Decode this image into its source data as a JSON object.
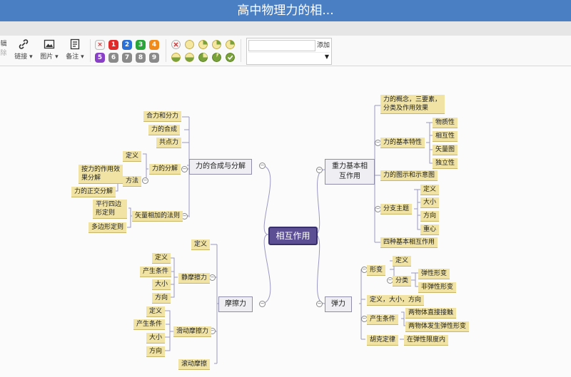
{
  "window": {
    "title": "高中物理力的相..."
  },
  "toolbar": {
    "partial_top": "辑",
    "partial_bottom": "除",
    "link": "链接",
    "image": "图片",
    "note": "备注",
    "priority_icons": [
      "×",
      "1",
      "2",
      "3",
      "4",
      "5",
      "6",
      "7",
      "8",
      "9"
    ],
    "priority_colors": [
      "#f5f5f5",
      "#e02a2a",
      "#2a6fd6",
      "#2aa53a",
      "#f08a1a",
      "#8a3fc9",
      "#8a8a8a",
      "#8a8a8a",
      "#8a8a8a",
      "#8a8a8a"
    ],
    "add_label": "添加"
  },
  "map": {
    "center": "相互作用",
    "b1": {
      "label": "力的合成与分解",
      "n1": "合力和分力",
      "n2": "力的合成",
      "n3": "共点力",
      "n4": "力的分解",
      "n4a": "定义",
      "n4b": "方法",
      "n4b1": "按力的作用效果分解",
      "n4b2": "力的正交分解",
      "n5": "矢量相加的法则",
      "n5a": "平行四边形定则",
      "n5b": "多边形定则"
    },
    "b2": {
      "label": "重力基本相互作用",
      "n1": "力的概念，三要素，分类及作用效果",
      "n2": "力的基本特性",
      "n2a": "物质性",
      "n2b": "相互性",
      "n2c": "矢量图",
      "n2d": "独立性",
      "n3": "力的图示和示意图",
      "n4": "分支主题",
      "n4a": "定义",
      "n4b": "大小",
      "n4c": "方向",
      "n4d": "重心",
      "n5": "四种基本相互作用"
    },
    "b3": {
      "label": "摩擦力",
      "n1": "定义",
      "n2": "静摩擦力",
      "n2a": "定义",
      "n2b": "产生条件",
      "n2c": "大小",
      "n2d": "方向",
      "n3": "滑动摩擦力",
      "n3a": "定义",
      "n3b": "产生条件",
      "n3c": "大小",
      "n3d": "方向",
      "n4": "滚动摩擦"
    },
    "b4": {
      "label": "弹力",
      "n1": "形变",
      "n1a": "定义",
      "n1b": "分类",
      "n1b1": "弹性形变",
      "n1b2": "非弹性形变",
      "n2": "定义，大小，方向",
      "n3": "产生条件",
      "n3a": "两物体直接接触",
      "n3b": "两物体发生弹性形变",
      "n4": "胡克定律",
      "n4a": "在弹性限度内"
    }
  }
}
